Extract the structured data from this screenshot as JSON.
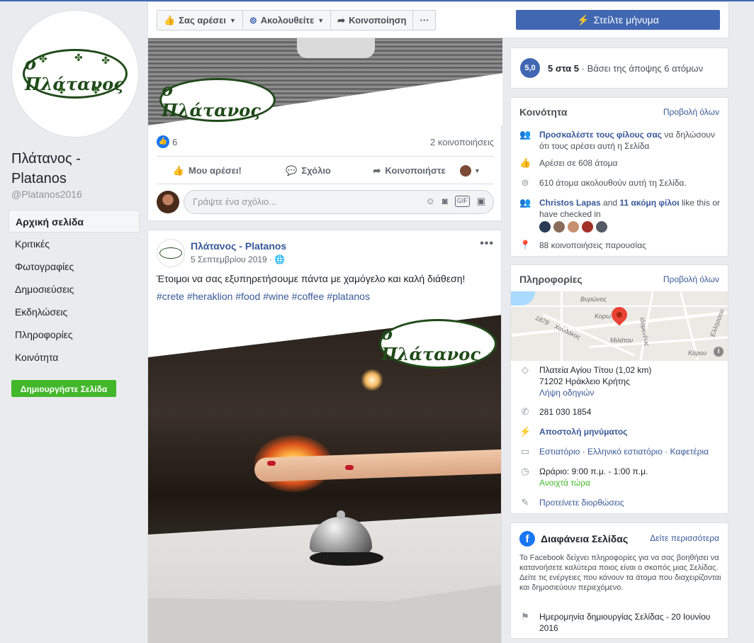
{
  "page": {
    "name": "Πλάτανος - Platanos",
    "handle": "@Platanos2016",
    "logo_text": "ο Πλάτανος"
  },
  "nav": {
    "items": [
      "Αρχική σελίδα",
      "Κριτικές",
      "Φωτογραφίες",
      "Δημοσιεύσεις",
      "Εκδηλώσεις",
      "Πληροφορίες",
      "Κοινότητα"
    ],
    "create_label": "Δημιουργήστε Σελίδα"
  },
  "topbar": {
    "like": "Σας αρέσει",
    "follow": "Ακολουθείτε",
    "share": "Κοινοποίηση",
    "more": "···",
    "message": "Στείλτε μήνυμα"
  },
  "post1": {
    "reaction_count": "6",
    "shares": "2 κοινοποιήσεις",
    "like_btn": "Μου αρέσει!",
    "comment_btn": "Σχόλιο",
    "share_btn": "Κοινοποιήστε",
    "comment_placeholder": "Γράψτε ένα σχόλιο..."
  },
  "post2": {
    "author": "Πλάτανος - Platanos",
    "date": "5 Σεπτεμβρίου 2019 · ",
    "text": "Έτοιμοι να σας εξυπηρετήσουμε πάντα με χαμόγελο και καλή διάθεση!",
    "tags": "#crete #heraklion #food #wine #coffee #platanos"
  },
  "rating": {
    "badge": "5,0",
    "score": "5 στα 5",
    "basis": " · Βάσει της άποψης 6 ατόμων"
  },
  "community": {
    "title": "Κοινότητα",
    "view_all": "Προβολή όλων",
    "invite_link": "Προσκαλέστε τους φίλους σας",
    "invite_rest": " να δηλώσουν ότι τους αρέσει αυτή η Σελίδα",
    "likes": "Αρέσει σε 608 άτομα",
    "follows": "610 άτομα ακολουθούν αυτή τη Σελίδα.",
    "friend": "Christos Lapas",
    "and": " and ",
    "more_friends": "11 ακόμη φίλοι",
    "friends_rest": " like this or have checked in",
    "checkins": "88 κοινοποιήσεις παρουσίας"
  },
  "info": {
    "title": "Πληροφορίες",
    "view_all": "Προβολή όλων",
    "map_labels": [
      "Βυρώνος",
      "Κορω",
      "Χανδάκος",
      "Μιλάτου",
      "Έλλησσου",
      "Κάρου",
      "Ιδομενέως",
      "1878"
    ],
    "address1": "Πλατεία Αγίου Τίτου (1,02 km)",
    "address2": "71202 Ηράκλειο Κρήτης",
    "directions": "Λήψη οδηγιών",
    "phone": "281 030 1854",
    "messaging": "Αποστολή μηνύματος",
    "categories": "Εστιατόριο · Ελληνικό εστιατόριο · Καφετέρια",
    "hours": "Ωράριο: 9:00 π.μ. - 1:00 π.μ.",
    "open_now": "Ανοιχτά τώρα",
    "suggest": "Προτείνετε διορθώσεις"
  },
  "transparency": {
    "title": "Διαφάνεια Σελίδας",
    "see_more": "Δείτε περισσότερα",
    "description": "Το Facebook δείχνει πληροφορίες για να σας βοηθήσει να κατανοήσετε καλύτερα ποιος είναι ο σκοπός μιας Σελίδας. Δείτε τις ενέργειες που κάνουν τα άτομα που διαχειρίζονται και δημοσιεύουν περιεχόμενο.",
    "created": "Ημερομηνία δημιουργίας Σελίδας - 20 Ιουνίου 2016"
  },
  "colors": {
    "brand_blue": "#4267b2",
    "link_blue": "#385898",
    "green": "#42b72a",
    "logo_green": "#1f4a19"
  }
}
